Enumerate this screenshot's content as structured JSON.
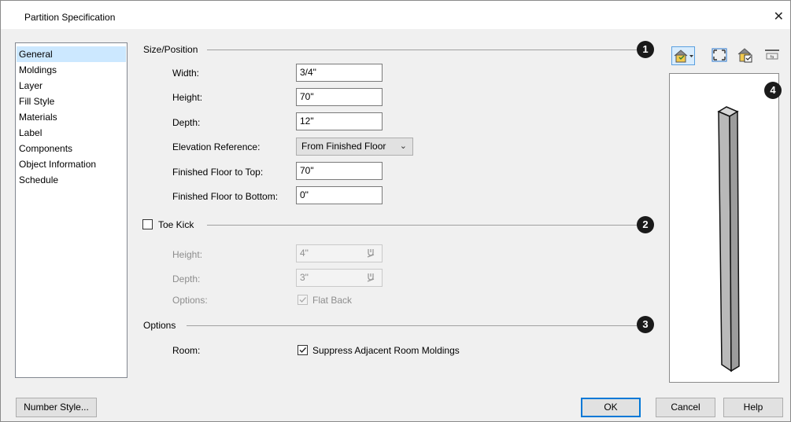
{
  "window": {
    "title": "Partition Specification",
    "close_glyph": "✕"
  },
  "categories": [
    {
      "label": "General",
      "selected": true
    },
    {
      "label": "Moldings"
    },
    {
      "label": "Layer"
    },
    {
      "label": "Fill Style"
    },
    {
      "label": "Materials"
    },
    {
      "label": "Label"
    },
    {
      "label": "Components"
    },
    {
      "label": "Object Information"
    },
    {
      "label": "Schedule"
    }
  ],
  "size_position": {
    "heading": "Size/Position",
    "badge": "1",
    "width_label": "Width:",
    "width_value": "3/4\"",
    "height_label": "Height:",
    "height_value": "70\"",
    "depth_label": "Depth:",
    "depth_value": "12\"",
    "elevation_label": "Elevation Reference:",
    "elevation_value": "From Finished Floor",
    "top_label": "Finished Floor to Top:",
    "top_value": "70\"",
    "bottom_label": "Finished Floor to Bottom:",
    "bottom_value": "0\""
  },
  "toe_kick": {
    "heading": "Toe Kick",
    "badge": "2",
    "checked": false,
    "height_label": "Height:",
    "height_value": "4\"",
    "depth_label": "Depth:",
    "depth_value": "3\"",
    "options_label": "Options:",
    "flat_back_label": "Flat Back",
    "flat_back_checked": true
  },
  "options": {
    "heading": "Options",
    "badge": "3",
    "room_label": "Room:",
    "suppress_label": "Suppress Adjacent Room Moldings",
    "suppress_checked": true
  },
  "preview": {
    "badge": "4",
    "icons": [
      "camera-view-dropdown-icon",
      "fill-window-icon",
      "color-view-icon",
      "toolbar-toggle-icon"
    ]
  },
  "buttons": {
    "number_style": "Number Style...",
    "ok": "OK",
    "cancel": "Cancel",
    "help": "Help"
  },
  "colors": {
    "selection": "#cce8ff",
    "default_button_border": "#0078d7",
    "badge": "#1a1a1a"
  }
}
